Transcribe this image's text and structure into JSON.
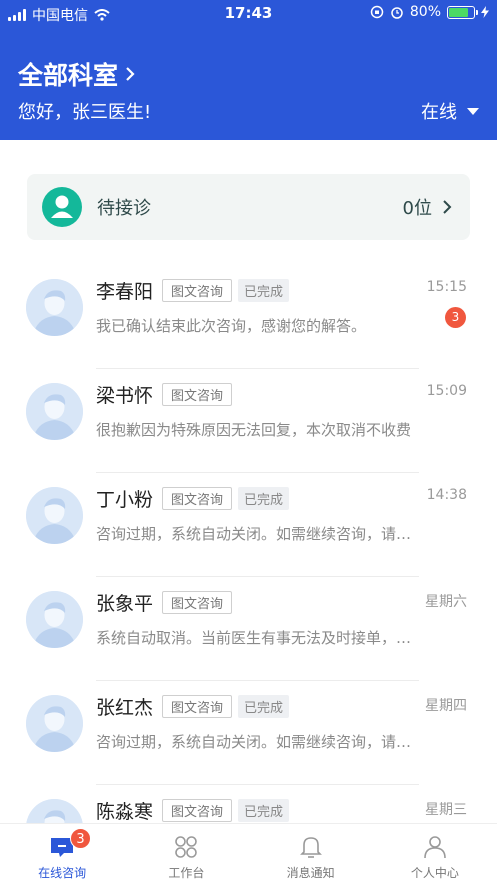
{
  "status_bar": {
    "carrier": "中国电信",
    "time": "17:43",
    "battery": "80%",
    "battery_level": 0.8
  },
  "header": {
    "department": "全部科室",
    "greeting": "您好，张三医生!",
    "status": "在线"
  },
  "waiting": {
    "label": "待接诊",
    "count": "0位"
  },
  "consultations": [
    {
      "name": "李春阳",
      "type": "图文咨询",
      "state": "已完成",
      "time": "15:15",
      "message": "我已确认结束此次咨询，感谢您的解答。",
      "unread": "3"
    },
    {
      "name": "梁书怀",
      "type": "图文咨询",
      "state": "",
      "time": "15:09",
      "message": "很抱歉因为特殊原因无法回复，本次取消不收费",
      "unread": ""
    },
    {
      "name": "丁小粉",
      "type": "图文咨询",
      "state": "已完成",
      "time": "14:38",
      "message": "咨询过期，系统自动关闭。如需继续咨询，请重新发起",
      "unread": ""
    },
    {
      "name": "张象平",
      "type": "图文咨询",
      "state": "",
      "time": "星期六",
      "message": "系统自动取消。当前医生有事无法及时接单，请稍后再试",
      "unread": ""
    },
    {
      "name": "张红杰",
      "type": "图文咨询",
      "state": "已完成",
      "time": "星期四",
      "message": "咨询过期，系统自动关闭。如需继续咨询，请重新发起",
      "unread": ""
    },
    {
      "name": "陈淼寒",
      "type": "图文咨询",
      "state": "已完成",
      "time": "星期三",
      "message": "",
      "unread": ""
    }
  ],
  "tabbar": {
    "tabs": [
      {
        "label": "在线咨询",
        "icon": "chat-icon",
        "badge": "3"
      },
      {
        "label": "工作台",
        "icon": "grid-icon",
        "badge": ""
      },
      {
        "label": "消息通知",
        "icon": "bell-icon",
        "badge": ""
      },
      {
        "label": "个人中心",
        "icon": "person-icon",
        "badge": ""
      }
    ]
  },
  "colors": {
    "primary": "#2b57d8",
    "badge": "#f0573e",
    "waiting_icon": "#14b89a",
    "battery_fill": "#4cd964"
  }
}
